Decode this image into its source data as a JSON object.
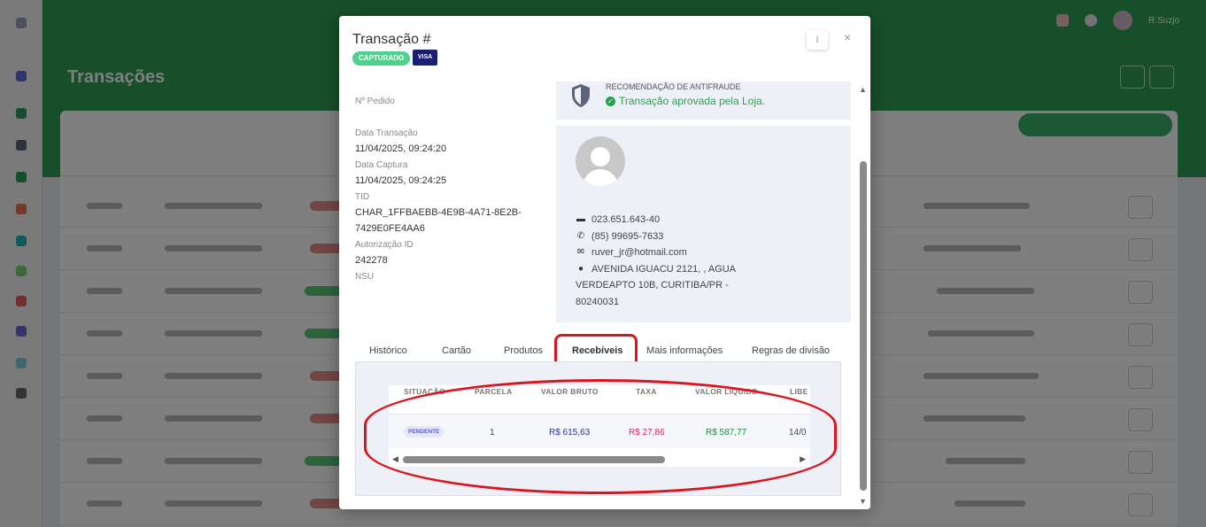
{
  "background": {
    "page_title": "Transações",
    "user_name": "R.Suzjo"
  },
  "modal": {
    "title": "Transação #",
    "status_badge": "CAPTURADO",
    "card_brand": "VISA",
    "info_button": "i",
    "close_button": "×",
    "fields": {
      "order_label": "Nº Pedido",
      "transaction_date_label": "Data Transação",
      "transaction_date_value": "11/04/2025, 09:24:20",
      "capture_date_label": "Data Captura",
      "capture_date_value": "11/04/2025, 09:24:25",
      "tid_label": "TID",
      "tid_value_line1": "CHAR_1FFBAEBB-4E9B-4A71-8E2B-",
      "tid_value_line2": "7429E0FE4AA6",
      "auth_label": "Autorização ID",
      "auth_value": "242278",
      "nsu_label": "NSU"
    },
    "antifraud": {
      "title": "RECOMENDAÇÃO DE ANTIFRAUDE",
      "message": "Transação aprovada pela Loja."
    },
    "customer": {
      "document": "023.651.643-40",
      "phone": "(85) 99695-7633",
      "email": "ruver_jr@hotmail.com",
      "address_line1": "AVENIDA IGUACU 2121, , AGUA",
      "address_line2": "VERDEAPTO 10B, CURITIBA/PR -",
      "address_line3": "80240031"
    },
    "tabs": [
      {
        "label": "Histórico"
      },
      {
        "label": "Cartão"
      },
      {
        "label": "Produtos"
      },
      {
        "label": "Recebíveis"
      },
      {
        "label": "Mais informações"
      },
      {
        "label": "Regras de divisão"
      }
    ],
    "receivables_table": {
      "headers": [
        "SITUAÇÃO",
        "PARCELA",
        "VALOR BRUTO",
        "TAXA",
        "VALOR LÍQUIDO",
        "LIBE"
      ],
      "rows": [
        {
          "status": "PENDENTE",
          "installment": "1",
          "gross": "R$ 615,63",
          "fee": "R$ 27,86",
          "net": "R$ 587,77",
          "release": "14/0"
        }
      ]
    },
    "colors": {
      "accent_green": "#2c9e52",
      "gross_blue": "#2a2f9e",
      "fee_red": "#e0245e",
      "net_green": "#1f8a3a",
      "highlight_red": "#e0121b"
    }
  }
}
